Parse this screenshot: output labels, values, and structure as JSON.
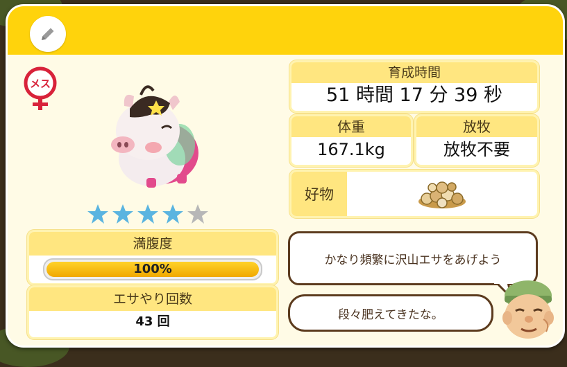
{
  "pig": {
    "gender": "メス",
    "rating": 4,
    "rating_max": 5
  },
  "stats": {
    "satiety_label": "満腹度",
    "satiety_value": "100%",
    "satiety_fraction": 1.0,
    "feed_count_label": "エサやり回数",
    "feed_count_value": "43 回"
  },
  "details": {
    "time_label": "育成時間",
    "time_value": "51 時間 17 分 39 秒",
    "weight_label": "体重",
    "weight_value": "167.1kg",
    "grazing_label": "放牧",
    "grazing_value": "放牧不要",
    "favorite_label": "好物",
    "favorite_icon": "feed-pellets-icon"
  },
  "advice": {
    "bubble1": "かなり頻繁に沢山エサをあげよう",
    "bubble2": "段々肥えてきたな。"
  },
  "colors": {
    "header": "#ffd30c",
    "card": "#fffbe6",
    "panel_head": "#ffe680",
    "star_on": "#5ab4e0",
    "star_off": "#b7b7b7",
    "gender": "#d8223a",
    "bar": "#f5b800"
  }
}
